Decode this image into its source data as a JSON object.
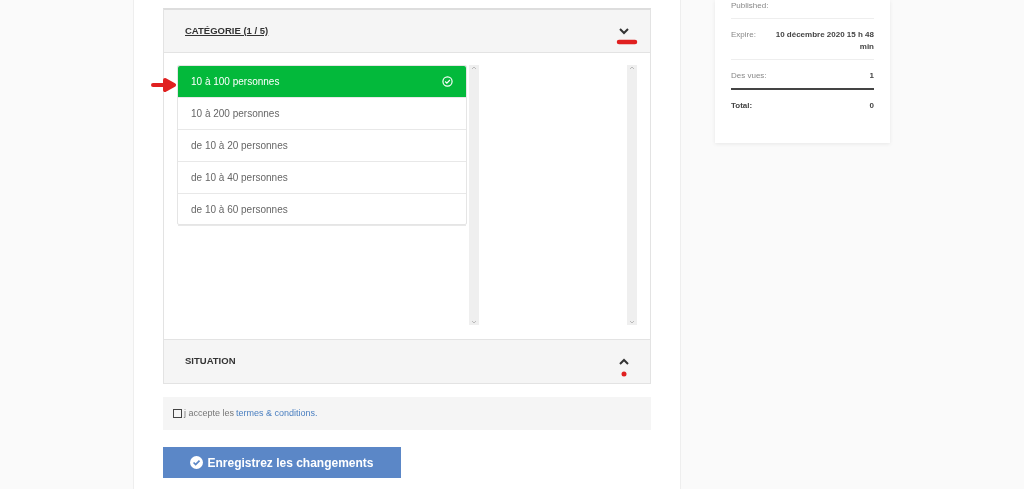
{
  "sections": [
    {
      "title": "CATÉGORIE (1 / 5)",
      "expanded": true,
      "options": [
        {
          "label": "10 à 100 personnes",
          "selected": true
        },
        {
          "label": "10 à 200 personnes",
          "selected": false
        },
        {
          "label": "de 10 à 20 personnes",
          "selected": false
        },
        {
          "label": "de 10 à 40 personnes",
          "selected": false
        },
        {
          "label": "de 10 à 60 personnes",
          "selected": false
        }
      ]
    },
    {
      "title": "SITUATION",
      "expanded": false
    }
  ],
  "terms": {
    "checked": false,
    "text": "j accepte les",
    "link": "termes & conditions."
  },
  "save_button": "Enregistrez les changements",
  "summary": {
    "rows": [
      {
        "kind": "plain",
        "label": "Published:"
      },
      {
        "kind": "plain",
        "label": "Expire:",
        "value": "10 décembre 2020 15 h 48 min"
      },
      {
        "kind": "plain",
        "label": "Des vues:",
        "value": "1"
      },
      {
        "kind": "total",
        "label": "Total:",
        "value": "0"
      }
    ]
  }
}
